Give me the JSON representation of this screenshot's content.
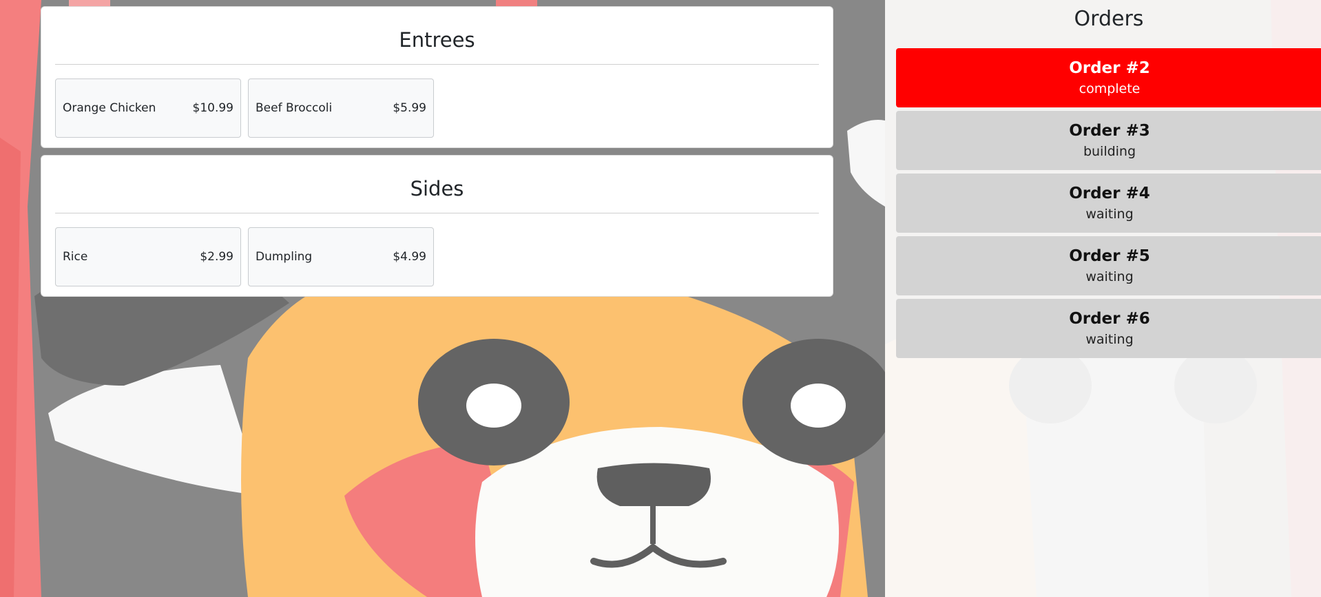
{
  "menu": {
    "categories": [
      {
        "title": "Entrees",
        "items": [
          {
            "name": "Orange Chicken",
            "price": "$10.99"
          },
          {
            "name": "Beef Broccoli",
            "price": "$5.99"
          }
        ]
      },
      {
        "title": "Sides",
        "items": [
          {
            "name": "Rice",
            "price": "$2.99"
          },
          {
            "name": "Dumpling",
            "price": "$4.99"
          }
        ]
      }
    ]
  },
  "orders": {
    "title": "Orders",
    "list": [
      {
        "number": "Order #2",
        "status": "complete",
        "active": true
      },
      {
        "number": "Order #3",
        "status": "building",
        "active": false
      },
      {
        "number": "Order #4",
        "status": "waiting",
        "active": false
      },
      {
        "number": "Order #5",
        "status": "waiting",
        "active": false
      },
      {
        "number": "Order #6",
        "status": "waiting",
        "active": false
      }
    ]
  },
  "colors": {
    "active_order": "#ff0000",
    "inactive_order": "#d3d3d3",
    "card_background": "#ffffff",
    "item_background": "#f8f9fa"
  },
  "icons": {
    "background_image": "red-panda-mascot"
  }
}
